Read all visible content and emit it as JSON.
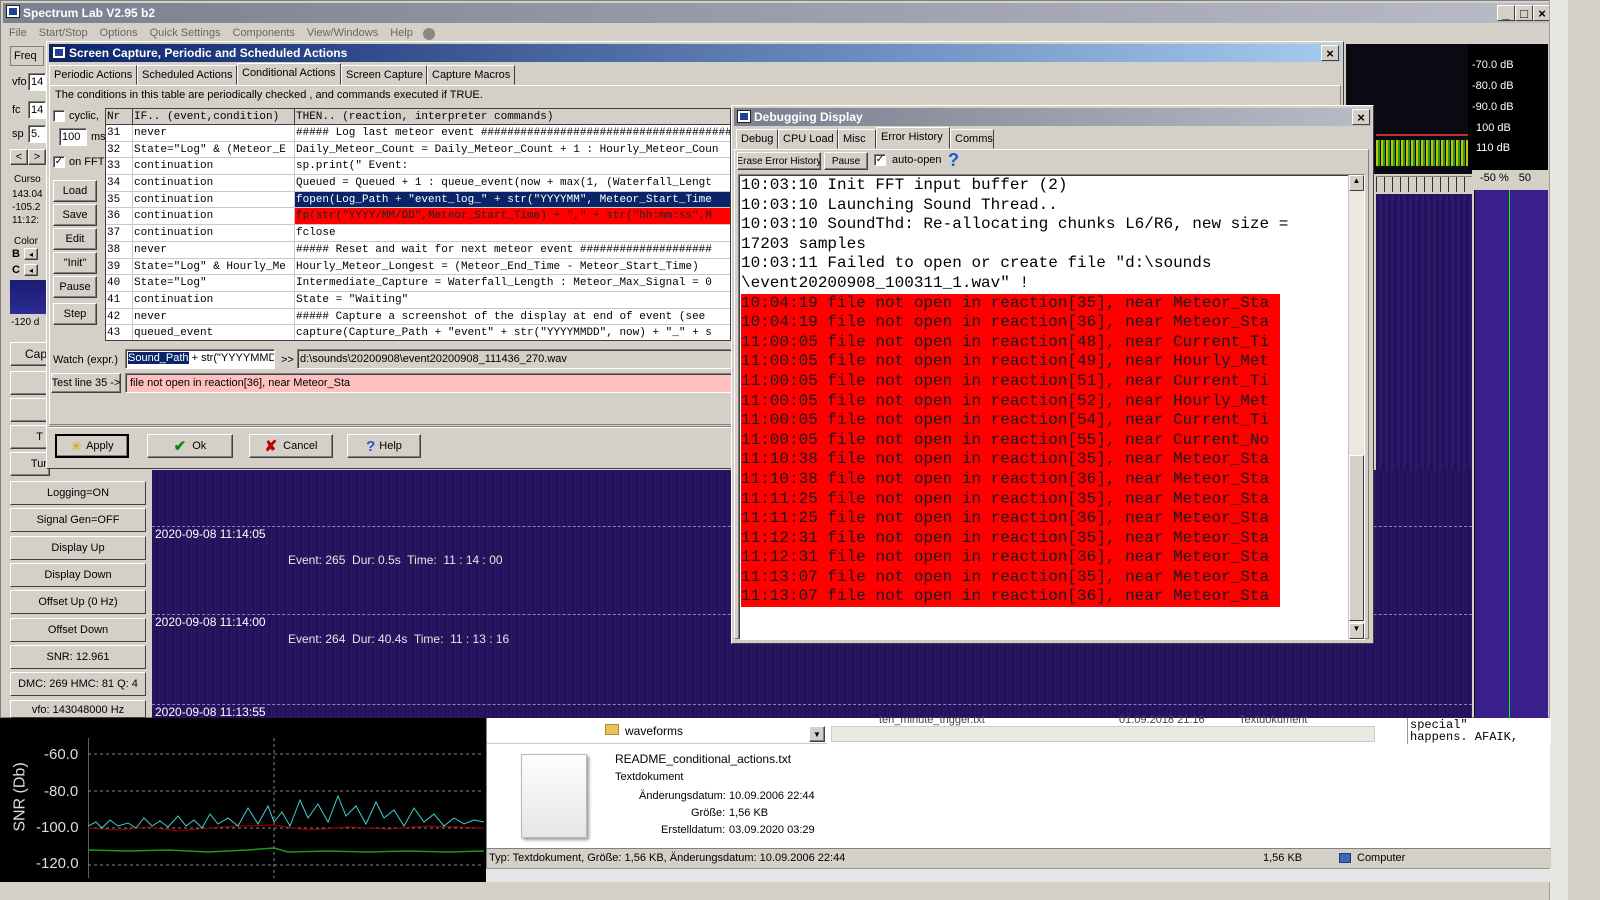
{
  "main_window": {
    "title": "Spectrum Lab V2.95 b2",
    "menu": [
      "File",
      "Start/Stop",
      "Options",
      "Quick Settings",
      "Components",
      "View/Windows",
      "Help"
    ]
  },
  "left_panel": {
    "tab": "Freq",
    "labels": [
      "vfo",
      "fc",
      "sp"
    ],
    "values": [
      "14",
      "14",
      "5."
    ],
    "cursor_label": "Curso",
    "cursor_values": [
      "143.04",
      "-105.2",
      "11:12:"
    ],
    "color_label": "Color",
    "bc": [
      "B",
      "C"
    ],
    "db_value": "-120 d",
    "cap_label": "Cap",
    "t_label": "T",
    "tur_label": "Tur"
  },
  "side_buttons": [
    "Logging=ON",
    "Signal Gen=OFF",
    "Display Up",
    "Display Down",
    "Offset Up (0 Hz)",
    "Offset Down",
    "SNR: 12.961",
    "DMC: 269 HMC: 81 Q: 4",
    "vfo: 143048000 Hz"
  ],
  "waterfall": {
    "timestamps": [
      "2020-09-08 11:14:05",
      "2020-09-08 11:14:00",
      "2020-09-08 11:13:55"
    ],
    "events": [
      "Event: 265  Dur: 0.5s  Time:  11 : 14 : 00",
      "Event: 264  Dur: 40.4s  Time:  11 : 13 : 16"
    ]
  },
  "spectrum_scale": {
    "db_labels": [
      "-70.0 dB",
      "-80.0 dB",
      "-90.0 dB",
      "100 dB",
      "110 dB"
    ],
    "range": [
      "-50 %",
      "50"
    ]
  },
  "capture_dialog": {
    "title": "Screen Capture, Periodic and Scheduled Actions",
    "tabs": [
      "Periodic Actions",
      "Scheduled Actions",
      "Conditional Actions",
      "Screen Capture",
      "Capture Macros"
    ],
    "active_tab": "Conditional Actions",
    "description": "The conditions in this table are periodically checked , and commands executed if TRUE.",
    "cyclic_label": "cyclic,",
    "interval": "100",
    "ms": "ms",
    "on_fft": "on FFT",
    "left_buttons": [
      "Load",
      "Save",
      "Edit",
      "\"Init\"",
      "Pause",
      "Step"
    ],
    "columns": [
      "Nr",
      "IF.. (event,condition)",
      "THEN.. (reaction, interpreter commands)"
    ],
    "rows": [
      {
        "nr": "31",
        "if": "never",
        "then": "##### Log last meteor event ######################################"
      },
      {
        "nr": "32",
        "if": "State=\"Log\" & (Meteor_E",
        "then": "Daily_Meteor_Count = Daily_Meteor_Count + 1 : Hourly_Meteor_Coun"
      },
      {
        "nr": "33",
        "if": "continuation",
        "then": "sp.print(\"                                    Event:"
      },
      {
        "nr": "34",
        "if": "continuation",
        "then": "Queued = Queued + 1 : queue_event(now + max(1, (Waterfall_Lengt"
      },
      {
        "nr": "35",
        "if": "continuation",
        "then": "fopen(Log_Path + \"event_log_\" + str(\"YYYYMM\", Meteor_Start_Time"
      },
      {
        "nr": "36",
        "if": "continuation",
        "then": "fp(str(\"YYYY/MM/DD\",Meteor_Start_Time) + \",\" + str(\"hh:mm:ss\",M"
      },
      {
        "nr": "37",
        "if": "continuation",
        "then": "fclose"
      },
      {
        "nr": "38",
        "if": "never",
        "then": "##### Reset and wait for next meteor event ####################"
      },
      {
        "nr": "39",
        "if": "State=\"Log\" & Hourly_Me",
        "then": "Hourly_Meteor_Longest = (Meteor_End_Time - Meteor_Start_Time)"
      },
      {
        "nr": "40",
        "if": "State=\"Log\"",
        "then": "Intermediate_Capture = Waterfall_Length : Meteor_Max_Signal = 0"
      },
      {
        "nr": "41",
        "if": "continuation",
        "then": "State = \"Waiting\""
      },
      {
        "nr": "42",
        "if": "never",
        "then": "##### Capture a screenshot of the display at end of event (see"
      },
      {
        "nr": "43",
        "if": "queued_event",
        "then": "capture(Capture_Path + \"event\" + str(\"YYYYMMDD\", now) + \"_\" + s"
      }
    ],
    "watch_label": "Watch (expr.)",
    "watch_expr_sel": "Sound_Path",
    "watch_expr_rest": " + str(\"YYYYMMD",
    "watch_arrow": ">>",
    "watch_result": "d:\\sounds\\20200908\\event20200908_111436_270.wav",
    "test_label": "Test line 35 ->",
    "test_result": "file not open in reaction[36], near Meteor_Sta",
    "bottom_buttons": [
      "Apply",
      "Ok",
      "Cancel",
      "Help"
    ]
  },
  "debug_dialog": {
    "title": "Debugging Display",
    "tabs": [
      "Debug",
      "CPU Load",
      "Misc",
      "Error History",
      "Comms"
    ],
    "toolbar": {
      "erase": "Erase Error History",
      "pause": "Pause",
      "auto_open": "auto-open",
      "help": "?"
    },
    "normal_lines": [
      "10:03:10 Init FFT input buffer (2)",
      "10:03:10 Launching Sound Thread..",
      "10:03:10 SoundThd: Re-allocating chunks L6/R6, new size =",
      "17203 samples",
      "10:03:11 Failed to open or create file \"d:\\sounds",
      "\\event20200908_100311_1.wav\" !"
    ],
    "error_lines": [
      "10:04:19 file not open in reaction[35], near Meteor_Sta",
      "10:04:19 file not open in reaction[36], near Meteor_Sta",
      "11:00:05 file not open in reaction[48], near Current_Ti",
      "11:00:05 file not open in reaction[49], near Hourly_Met",
      "11:00:05 file not open in reaction[51], near Current_Ti",
      "11:00:05 file not open in reaction[52], near Hourly_Met",
      "11:00:05 file not open in reaction[54], near Current_Ti",
      "11:00:05 file not open in reaction[55], near Current_No",
      "11:10:38 file not open in reaction[35], near Meteor_Sta",
      "11:10:38 file not open in reaction[36], near Meteor_Sta",
      "11:11:25 file not open in reaction[35], near Meteor_Sta",
      "11:11:25 file not open in reaction[36], near Meteor_Sta",
      "11:12:31 file not open in reaction[35], near Meteor_Sta",
      "11:12:31 file not open in reaction[36], near Meteor_Sta",
      "11:13:07 file not open in reaction[35], near Meteor_Sta",
      "11:13:07 file not open in reaction[36], near Meteor_Sta"
    ]
  },
  "snr_plot": {
    "ylabel": "SNR (Db)",
    "ticks": [
      "-60.0",
      "-80.0",
      "-100.0",
      "-120.0"
    ]
  },
  "explorer": {
    "folder": "waveforms",
    "file_top": "ten_minute_trigger.txt",
    "file_top_date": "01.09.2018 21:16",
    "file_top_type": "Textdokument",
    "file_name": "README_conditional_actions.txt",
    "file_type": "Textdokument",
    "props": [
      {
        "k": "Änderungsdatum:",
        "v": "10.09.2006 22:44"
      },
      {
        "k": "Größe:",
        "v": "1,56 KB"
      },
      {
        "k": "Erstelldatum:",
        "v": "03.09.2020 03:29"
      }
    ],
    "status": "Typ: Textdokument, Größe: 1,56 KB, Änderungsdatum: 10.09.2006 22:44",
    "status_size": "1,56 KB",
    "status_loc": "Computer"
  },
  "text_snippet": [
    "special\"",
    "happens. AFAIK,"
  ]
}
